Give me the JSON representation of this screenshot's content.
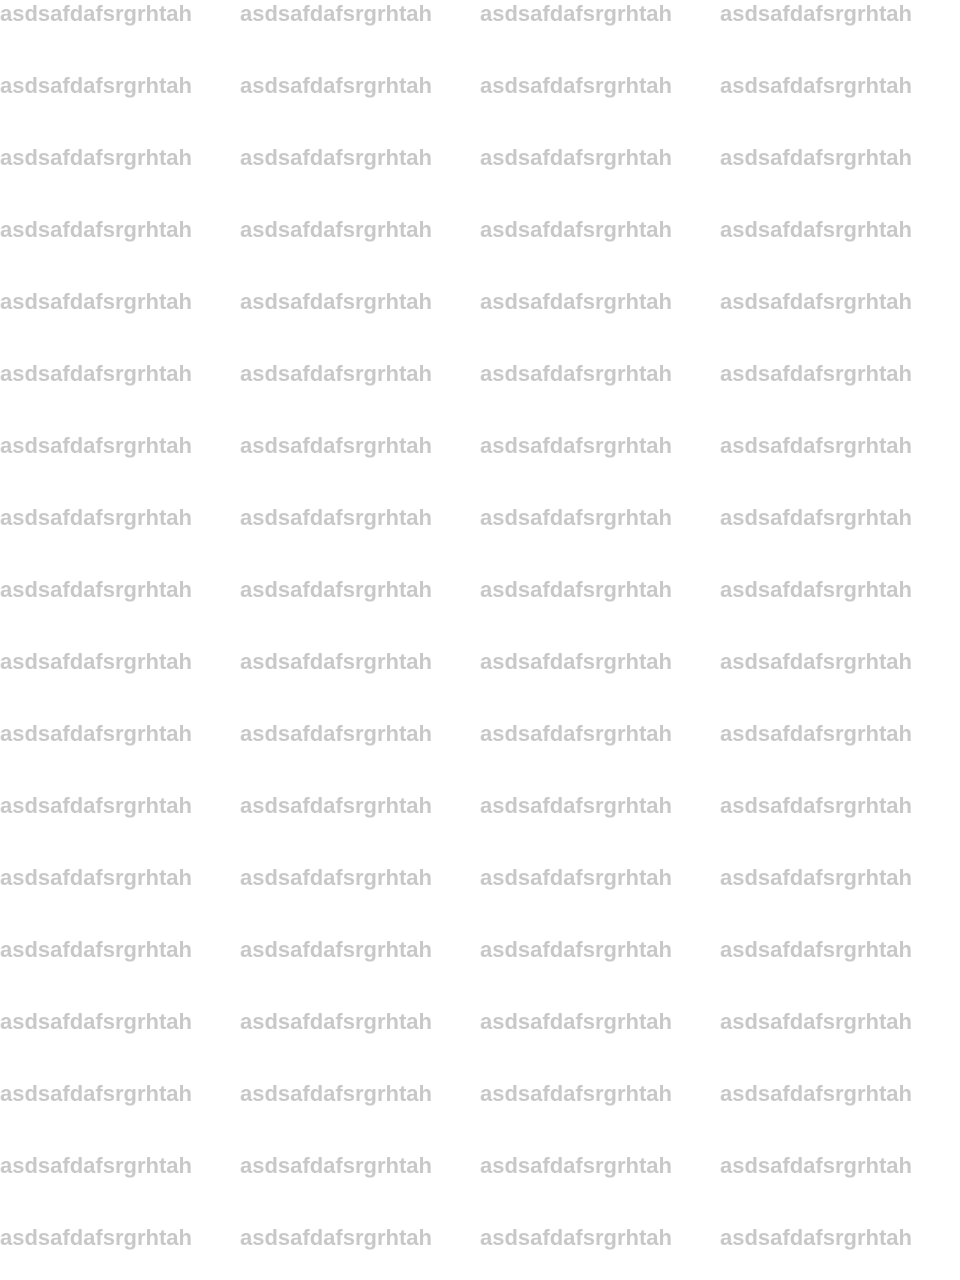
{
  "watermark": {
    "text": "asdsafdafsrgrhtah",
    "color": "#c8c8c8",
    "rows": 18,
    "columns": 4
  }
}
